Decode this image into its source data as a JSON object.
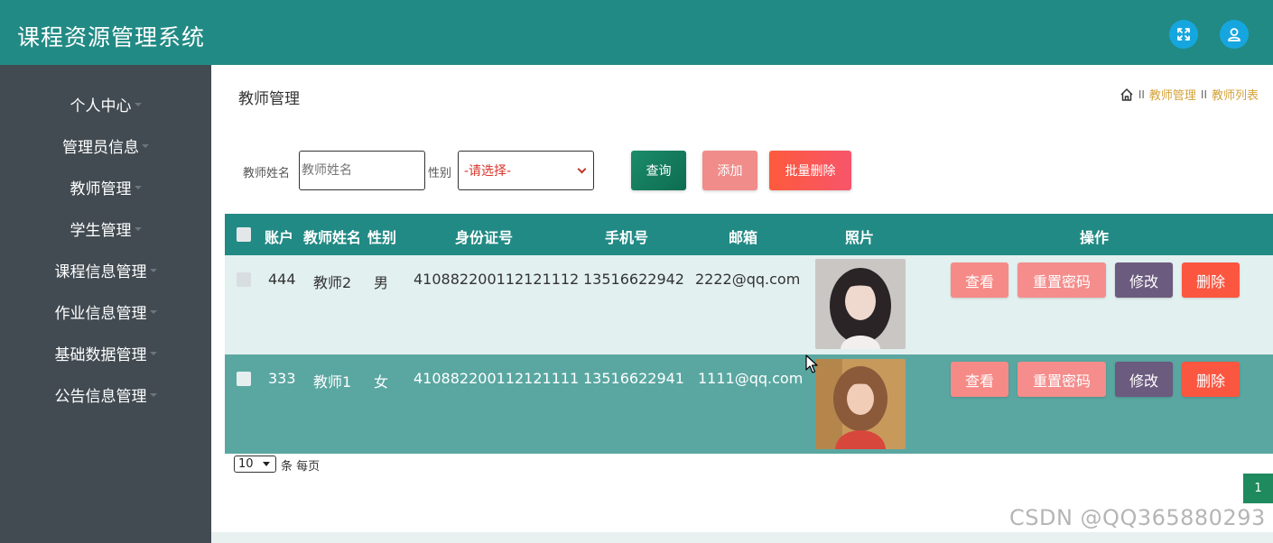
{
  "app": {
    "title": "课程资源管理系统"
  },
  "header_icons": [
    {
      "name": "fullscreen-icon",
      "color": "#16a6df"
    },
    {
      "name": "user-icon",
      "color": "#16a6df"
    }
  ],
  "sidebar": {
    "items": [
      {
        "label": "个人中心"
      },
      {
        "label": "管理员信息"
      },
      {
        "label": "教师管理"
      },
      {
        "label": "学生管理"
      },
      {
        "label": "课程信息管理"
      },
      {
        "label": "作业信息管理"
      },
      {
        "label": "基础数据管理"
      },
      {
        "label": "公告信息管理"
      }
    ]
  },
  "page": {
    "title": "教师管理",
    "breadcrumb": {
      "sep": "II",
      "level1": "教师管理",
      "level2": "教师列表"
    }
  },
  "search": {
    "name_label": "教师姓名",
    "name_placeholder": "教师姓名",
    "gender_label": "性别",
    "gender_selected": "-请选择-",
    "query_button": "查询",
    "add_button": "添加",
    "batch_delete_button": "批量删除"
  },
  "table": {
    "headers": {
      "account": "账户",
      "name": "教师姓名",
      "gender": "性别",
      "id_card": "身份证号",
      "phone": "手机号",
      "email": "邮箱",
      "photo": "照片",
      "actions": "操作"
    },
    "rows": [
      {
        "account": "444",
        "name": "教师2",
        "gender": "男",
        "id_card": "410882200112121112",
        "phone": "13516622942",
        "email": "2222@qq.com"
      },
      {
        "account": "333",
        "name": "教师1",
        "gender": "女",
        "id_card": "410882200112121111",
        "phone": "13516622941",
        "email": "1111@qq.com"
      }
    ],
    "row_actions": {
      "view": "查看",
      "reset_password": "重置密码",
      "edit": "修改",
      "delete": "删除"
    }
  },
  "pagination": {
    "page_size": "10",
    "per_page_text": "条 每页",
    "current_page": "1"
  },
  "watermark": "CSDN @QQ365880293",
  "colors": {
    "primary": "#228a84",
    "sidebar": "#424b52",
    "query": "#157a5e",
    "add": "#f08c89",
    "batch_delete": "#fb5b45",
    "view": "#f68a86",
    "reset": "#f48d8c",
    "edit": "#6b5b7e",
    "delete": "#fb5640",
    "row_light": "#e2f0ef",
    "row_dark": "#5aa7a1"
  }
}
